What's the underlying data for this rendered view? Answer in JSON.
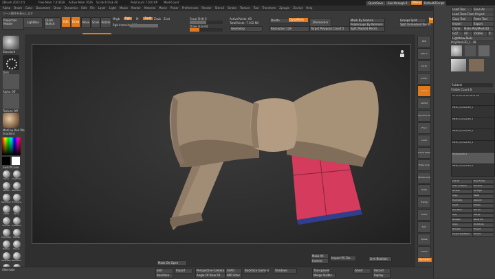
{
  "titlebar": {
    "left": "ZBrush 2022.0.5",
    "items": [
      "Free Mem 7.010GB",
      "Active Mem 7626",
      "Scratch Disk 40",
      "PolyCount 7.010 KP",
      "MeshCount"
    ],
    "quicksave": "QuickSave",
    "seethrough": "See-through 0",
    "menus_label": "Menus",
    "default_script": "DefaultZScript"
  },
  "menubar": [
    "Alpha",
    "Brush",
    "Color",
    "Document",
    "Draw",
    "Dynamics",
    "Edit",
    "File",
    "Layer",
    "Light",
    "Macro",
    "Marker",
    "Material",
    "Movie",
    "Picker",
    "Preferences",
    "Render",
    "Stencil",
    "Stroke",
    "Texture",
    "Tool",
    "Transform",
    "Zplugin",
    "Zscript",
    "Help"
  ],
  "notice": "ツール操作を表示します",
  "toolbar": {
    "projection_master": "Projection Master",
    "lightbox": "LightBox",
    "quick_sketch": "Quick Sketch",
    "edit": "Edit",
    "draw": "Draw",
    "move": "Move",
    "scale": "Scale",
    "rotate": "Rotate",
    "mrgb": "Mrgb",
    "rgb": "Rgb",
    "m": "M",
    "zadd": "Zadd",
    "zsub": "Zsub",
    "zcut": "Zcut",
    "focal_shift": "Focal Shift 0",
    "draw_size": "Draw Size 64",
    "dynamic": "Dynamic",
    "active_points": "ActivePoints: 60",
    "total_points": "TotalPoints: 7.102 Mil",
    "rgb_intensity": "Rgb Intensity 100",
    "z_intensity": "Z Intensity 25",
    "divide": "Divide",
    "geometry": "Geometry",
    "dynamesh": "DynaMesh",
    "resolution": "Resolution 128",
    "zremesher": "ZRemesher",
    "target_polygons": "Target Polygons Count 5",
    "mask_by_feature": "Mask By Feature",
    "polygroups_by_normals": "PolyGroups By Normals",
    "split_masked": "Split Masked Points",
    "groups_split": "Groups Split",
    "split_unmasked": "Split Unmasked Points",
    "mesh_by_polypaint": "Mesh By Polypaint",
    "rendered_subtools": "Backface Mask",
    "projection": "Projection Shell",
    "polish": "Polish 0"
  },
  "left_shelf": {
    "labels": [
      "Standard",
      "Dots",
      "Alpha Off",
      "Texture Off",
      "MatCap Red Wax",
      "Gradient",
      "SwitchColor",
      "Alternate"
    ],
    "brushes": [
      "Move",
      "ClayBuildup",
      "hPolish",
      "Standard",
      "DamStandard",
      "TrimDynamic",
      "Inflat",
      "Pinch",
      "Smooth",
      "SnakeHook",
      "ClayTubes",
      "hPolish",
      "Flatten",
      "Planar",
      "SelectRect",
      "ZModeler",
      "Polish",
      "Orb_Cracks"
    ],
    "bottom": [
      "Smooth",
      "Smooth Smooth",
      "Smooth Smooth",
      "Smooth"
    ]
  },
  "right_shelf": {
    "items": [
      "BPR",
      "SPix 3",
      "Scroll",
      "Zoom",
      "Actual",
      "AAHalf",
      "Dynamic Persp",
      "Floor",
      "Local",
      "Frame Mesh",
      "Edge Loop",
      "Stroke Loop",
      "Polyf",
      "Transp",
      "Ghost",
      "Solo",
      "Xpose",
      "Frame"
    ]
  },
  "tool_panel": {
    "load_tool": "Load Tool",
    "save_as": "Save As",
    "load_tools_from_project": "Load Tools From Project",
    "copy_tool": "Copy Tool",
    "paste_tool": "Paste Tool",
    "import": "Import",
    "export": "Export",
    "clone": "Clone",
    "make_polymesh": "Make PolyMesh3D",
    "goz": "GoZ",
    "all": "All",
    "visible": "Visible",
    "r": "R",
    "lightbox_tools": "Lightbox▸Tools",
    "current_tool": "PolyMesh3D_1. 48",
    "tool_thumbs": [
      "PolyMesh3D",
      "Cylinder PolyMesh3D",
      "SimpleBrush",
      "PolyMesh3D_1"
    ],
    "subtool_label": "Subtool",
    "visible_count": "Visible Count 8",
    "subtools": [
      "V1 V2 V3 V4 V5 V6 V7 V8",
      "PM3D_Cylinder3D_1",
      "PM3D_Cylinder3D_2",
      "PM3D_Cylinder3D_3",
      "PM3D_Cylinder3D_4",
      "PolyMesh3D_1",
      "PM3D_Cylinder3D_5"
    ],
    "list_all": "List All",
    "new_folder": "New Folder",
    "auto_collapse": "Auto Collapse",
    "rename": "Rename",
    "all_low": "All Low",
    "all_high": "All High",
    "copy": "Copy",
    "paste": "Paste",
    "duplicate": "Duplicate",
    "append": "Append",
    "insert": "Insert",
    "delete": "Delete",
    "del_other": "Del Other",
    "del_all": "Del All",
    "split": "Split",
    "merge": "Merge",
    "boolean": "Boolean",
    "bevel_pro": "Bevel Pro",
    "align": "Align",
    "distribute": "Distribute",
    "remesh": "Remesh",
    "project": "Project",
    "project_bas_relief": "Project BasRelief",
    "extract": "Extract"
  },
  "bottom_bar": {
    "mask_on_open": "Mask On Open",
    "edit_btn": "Edit",
    "backface": "Backface",
    "import": "Import",
    "perspective": "Perspective Camera",
    "focal": "Angle Of View 50",
    "ssao": "SSAO",
    "bpr_filter": "BPR Filter",
    "backface_gamma": "Backface Gamma",
    "shadows": "Shadows",
    "dynamic": "Dynamic",
    "mask_all": "Mask All",
    "inverse": "Inverse",
    "import_pd": "Import PS File",
    "live_boolean": "Live Boolean",
    "transp": "Transparent",
    "ghost": "Ghost",
    "merge_visible": "Merge Visible",
    "record": "Record",
    "replay": "Replay"
  },
  "colors": {
    "accent": "#e07a1a",
    "canvas": "#2b2b2b",
    "ribbon_clay": "#9e8a72",
    "pink": "#d43b5c",
    "blue": "#2f3f8e"
  }
}
